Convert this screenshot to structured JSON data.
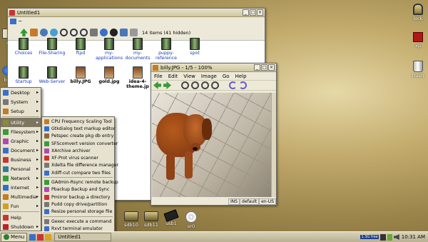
{
  "desktop": {
    "top_left_label": "w",
    "left_label": "bro",
    "right_icons": [
      {
        "label": "lock",
        "icon": "lock-icon"
      },
      {
        "label": "xp",
        "icon": "xp-icon"
      },
      {
        "label": "trash",
        "icon": "trash-icon"
      }
    ],
    "drives": [
      {
        "label": "sdb10",
        "icon": "drive-icon"
      },
      {
        "label": "sdb11",
        "icon": "drive-icon"
      },
      {
        "label": "usb1",
        "icon": "usb-drive-icon"
      },
      {
        "label": "sr0",
        "icon": "cdrom-icon"
      }
    ]
  },
  "filemanager": {
    "title": "Untitled1",
    "path": "~",
    "hidden_info": "14 items (41 hidden)",
    "items": [
      {
        "label": "Choices",
        "type": "folder"
      },
      {
        "label": "File-Sharing",
        "type": "folder"
      },
      {
        "label": "ftpd",
        "type": "folder"
      },
      {
        "label": "my-applications",
        "type": "folder"
      },
      {
        "label": "my-documents",
        "type": "folder"
      },
      {
        "label": "puppy-reference",
        "type": "folder"
      },
      {
        "label": "spot",
        "type": "folder"
      },
      {
        "label": "Startup",
        "type": "folder"
      },
      {
        "label": "Web-Server",
        "type": "folder"
      },
      {
        "label": "billy.JPG",
        "type": "image"
      },
      {
        "label": "gold.jpg",
        "type": "image"
      },
      {
        "label": "idea-4-theme.jp",
        "type": "image"
      }
    ]
  },
  "viewer": {
    "title": "billy.JPG - 1/5 - 100%",
    "menu": [
      "File",
      "Edit",
      "View",
      "Image",
      "Go",
      "Help"
    ],
    "status": [
      "INS",
      "default",
      "en-US"
    ]
  },
  "start_menu": {
    "items": [
      {
        "label": "Desktop",
        "arrow": true
      },
      {
        "label": "System",
        "arrow": true
      },
      {
        "label": "Setup",
        "arrow": true
      },
      {
        "label": "Utility",
        "arrow": true,
        "selected": true
      },
      {
        "label": "Filesystem",
        "arrow": true
      },
      {
        "label": "Graphic",
        "arrow": true
      },
      {
        "label": "Document",
        "arrow": true
      },
      {
        "label": "Business",
        "arrow": true
      },
      {
        "label": "Personal",
        "arrow": true
      },
      {
        "label": "Network",
        "arrow": true
      },
      {
        "label": "Internet",
        "arrow": true
      },
      {
        "label": "Multimedia",
        "arrow": true
      },
      {
        "label": "Fun",
        "arrow": true
      },
      {
        "label": "Help",
        "arrow": false
      },
      {
        "label": "Shutdown",
        "arrow": true
      }
    ]
  },
  "utility_menu": {
    "group1": [
      "CPU Frequency Scaling Tool",
      "Gtkdialog text markup editor",
      "Petspec create pkg db entry",
      "SFScomvert version converter",
      "XArchive archiver",
      "XF-Prot virus scanner",
      "Xdelta file difference manager",
      "Xdiff-cut compare two files"
    ],
    "group2": [
      "GAdmin-Rsync remote backup",
      "Pbackup Backup and Sync",
      "Pmirror backup a directory",
      "Pudd copy drive/partition",
      "Resize personal storage file"
    ],
    "group3": [
      "Gexec execute a command",
      "Rxvt terminal emulator",
      "Xconsole monitor console"
    ]
  },
  "taskbar": {
    "menu_label": "Menu",
    "task_label": "Untitled1",
    "clock": "10:31 AM",
    "tray_text": "1.3G free"
  }
}
